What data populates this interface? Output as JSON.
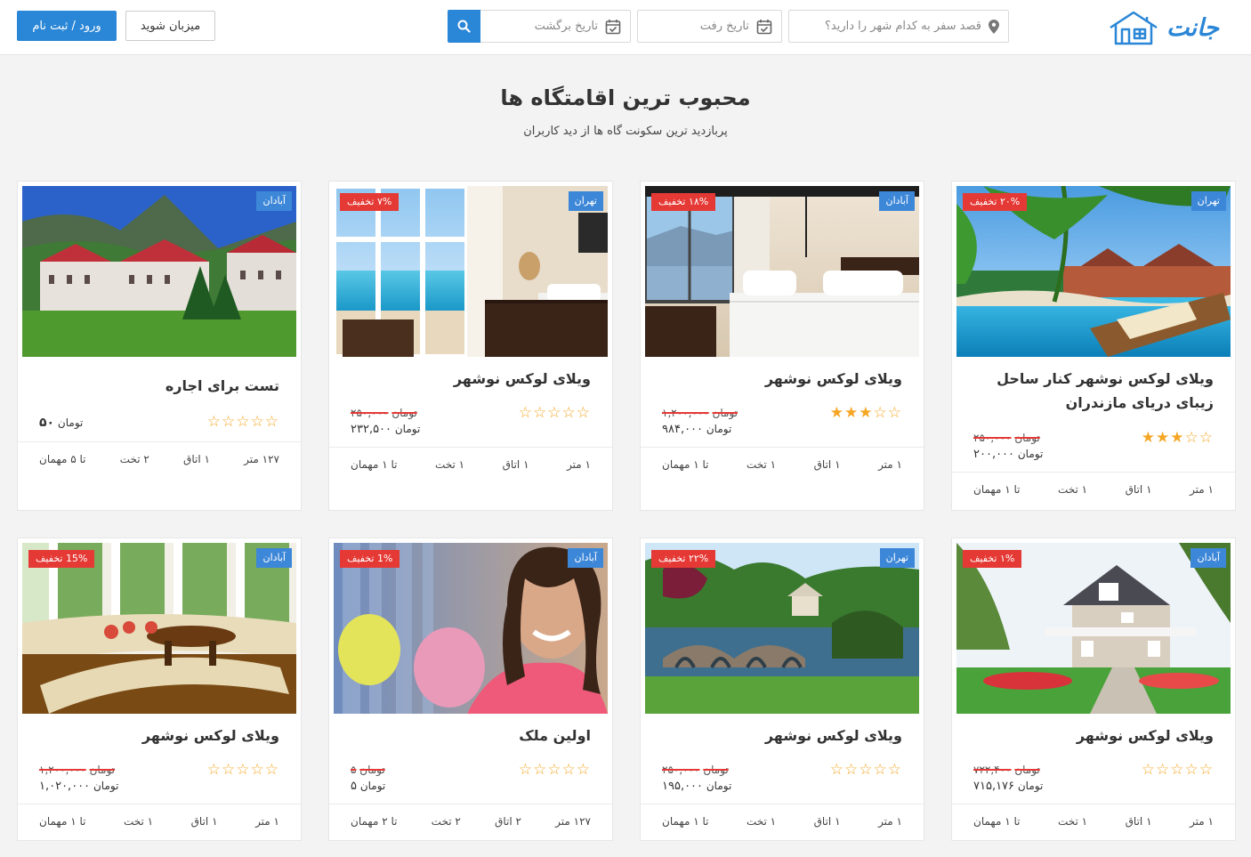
{
  "header": {
    "logo_text": "جانت",
    "city_placeholder": "قصد سفر به کدام شهر را دارید؟",
    "date_go_placeholder": "تاریخ رفت",
    "date_back_placeholder": "تاریخ برگشت",
    "host_label": "میزبان شوید",
    "login_label": "ورود / ثبت نام"
  },
  "section": {
    "title": "محبوب ترین اقامتگاه ها",
    "subtitle": "پربازدید ترین سکونت گاه ها از دید کاربران"
  },
  "colors": {
    "accent": "#2a86d6",
    "discount": "#e53935",
    "star": "#f5a623"
  },
  "cards": [
    {
      "city": "تهران",
      "discount": "۲۰% تخفیف",
      "title": "ویلای لوکس نوشهر کنار ساحل زیبای دریای مازندران",
      "stars": 3,
      "old_price": "۲۵۰,۰۰۰",
      "old_unit": "تومان",
      "price": "۲۰۰,۰۰۰",
      "unit": "تومان",
      "area": "۱ متر",
      "rooms": "۱ اتاق",
      "beds": "۱ تخت",
      "guests": "تا ۱ مهمان"
    },
    {
      "city": "آبادان",
      "discount": "۱۸% تخفیف",
      "title": "ویلای لوکس نوشهر",
      "stars": 3,
      "old_price": "۱,۲۰۰,۰۰۰",
      "old_unit": "تومان",
      "price": "۹۸۴,۰۰۰",
      "unit": "تومان",
      "area": "۱ متر",
      "rooms": "۱ اتاق",
      "beds": "۱ تخت",
      "guests": "تا ۱ مهمان"
    },
    {
      "city": "تهران",
      "discount": "۷% تخفیف",
      "title": "ویلای لوکس نوشهر",
      "stars": 0,
      "old_price": "۲۵۰,۰۰۰",
      "old_unit": "تومان",
      "price": "۲۳۲,۵۰۰",
      "unit": "تومان",
      "area": "۱ متر",
      "rooms": "۱ اتاق",
      "beds": "۱ تخت",
      "guests": "تا ۱ مهمان"
    },
    {
      "city": "آبادان",
      "discount": "",
      "title": "تست برای اجاره",
      "stars": 0,
      "old_price": "",
      "old_unit": "",
      "price": "۵۰",
      "unit": "تومان",
      "area": "۱۲۷ متر",
      "rooms": "۱ اتاق",
      "beds": "۲ تخت",
      "guests": "تا ۵ مهمان"
    },
    {
      "city": "آبادان",
      "discount": "۱% تخفیف",
      "title": "ویلای لوکس نوشهر",
      "stars": 0,
      "old_price": "۷۲۲,۴۰۰",
      "old_unit": "تومان",
      "price": "۷۱۵,۱۷۶",
      "unit": "تومان",
      "area": "۱ متر",
      "rooms": "۱ اتاق",
      "beds": "۱ تخت",
      "guests": "تا ۱ مهمان"
    },
    {
      "city": "تهران",
      "discount": "۲۲% تخفیف",
      "title": "ویلای لوکس نوشهر",
      "stars": 0,
      "old_price": "۲۵۰,۰۰۰",
      "old_unit": "تومان",
      "price": "۱۹۵,۰۰۰",
      "unit": "تومان",
      "area": "۱ متر",
      "rooms": "۱ اتاق",
      "beds": "۱ تخت",
      "guests": "تا ۱ مهمان"
    },
    {
      "city": "آبادان",
      "discount": "1% تخفیف",
      "title": "اولین ملک",
      "stars": 0,
      "old_price": "۵",
      "old_unit": "تومان",
      "price": "۵",
      "unit": "تومان",
      "area": "۱۲۷ متر",
      "rooms": "۲ اتاق",
      "beds": "۲ تخت",
      "guests": "تا ۲ مهمان"
    },
    {
      "city": "آبادان",
      "discount": "15% تخفیف",
      "title": "ویلای لوکس نوشهر",
      "stars": 0,
      "old_price": "۱,۲۰۰,۰۰۰",
      "old_unit": "تومان",
      "price": "۱,۰۲۰,۰۰۰",
      "unit": "تومان",
      "area": "۱ متر",
      "rooms": "۱ اتاق",
      "beds": "۱ تخت",
      "guests": "تا ۱ مهمان"
    }
  ]
}
